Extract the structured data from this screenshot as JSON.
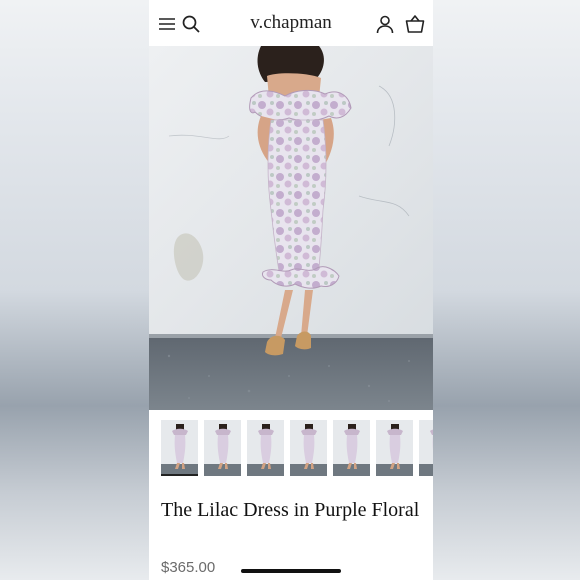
{
  "brand": {
    "name": "v.chapman"
  },
  "header": {
    "icons": [
      "menu-icon",
      "search-icon",
      "account-icon",
      "cart-icon"
    ]
  },
  "gallery": {
    "thumbnail_count": 7,
    "active_thumbnail": 1
  },
  "product": {
    "title": "The Lilac Dress in Purple Floral",
    "price": "$365.00"
  },
  "colors": {
    "accent": "#111111",
    "price_text": "#6b6b6b",
    "dress_floral": "#b79ac2"
  }
}
